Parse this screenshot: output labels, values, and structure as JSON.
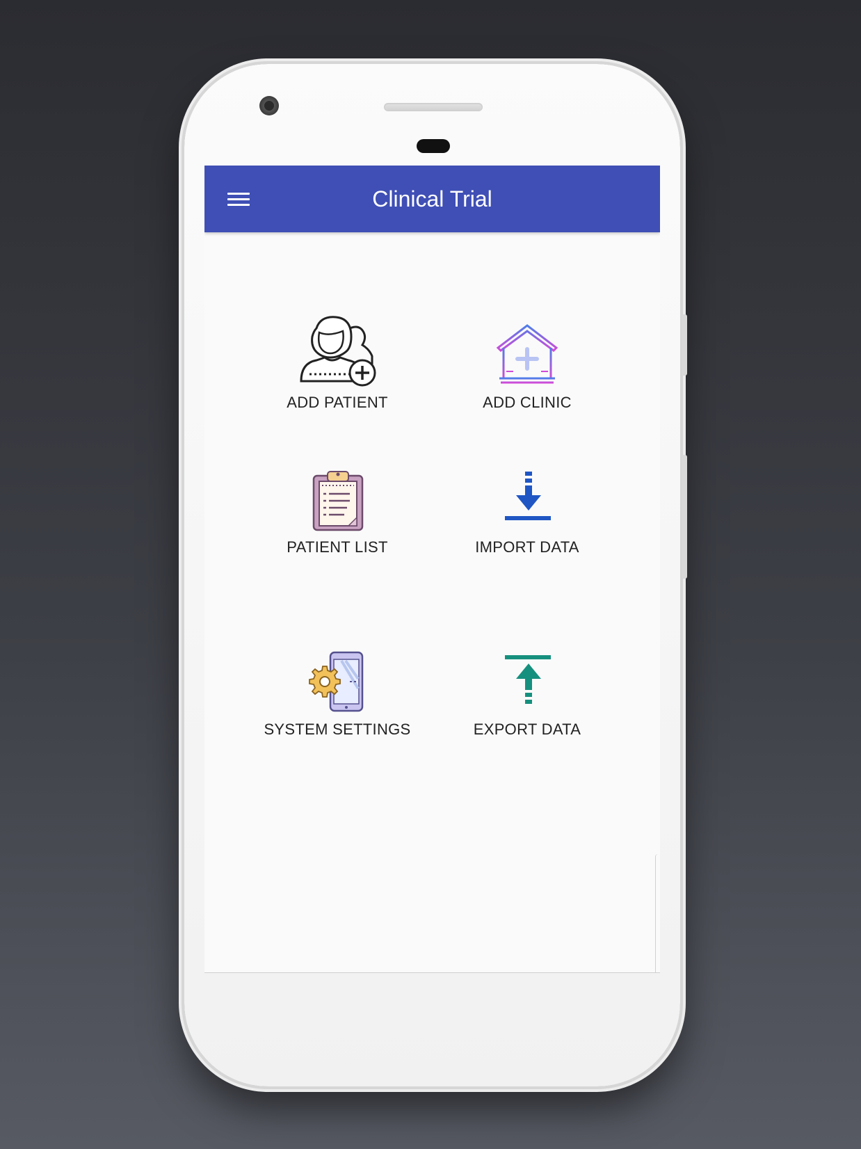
{
  "app": {
    "title": "Clinical Trial",
    "accent_color": "#3f4fb5"
  },
  "appbar": {
    "menu_icon": "hamburger-menu-icon"
  },
  "tiles": [
    {
      "label": "ADD PATIENT",
      "icon": "add-patient-icon"
    },
    {
      "label": "ADD CLINIC",
      "icon": "add-clinic-icon"
    },
    {
      "label": "PATIENT LIST",
      "icon": "clipboard-list-icon"
    },
    {
      "label": "IMPORT DATA",
      "icon": "download-arrow-icon"
    },
    {
      "label": "SYSTEM SETTINGS",
      "icon": "phone-settings-icon"
    },
    {
      "label": "EXPORT DATA",
      "icon": "upload-arrow-icon"
    }
  ]
}
